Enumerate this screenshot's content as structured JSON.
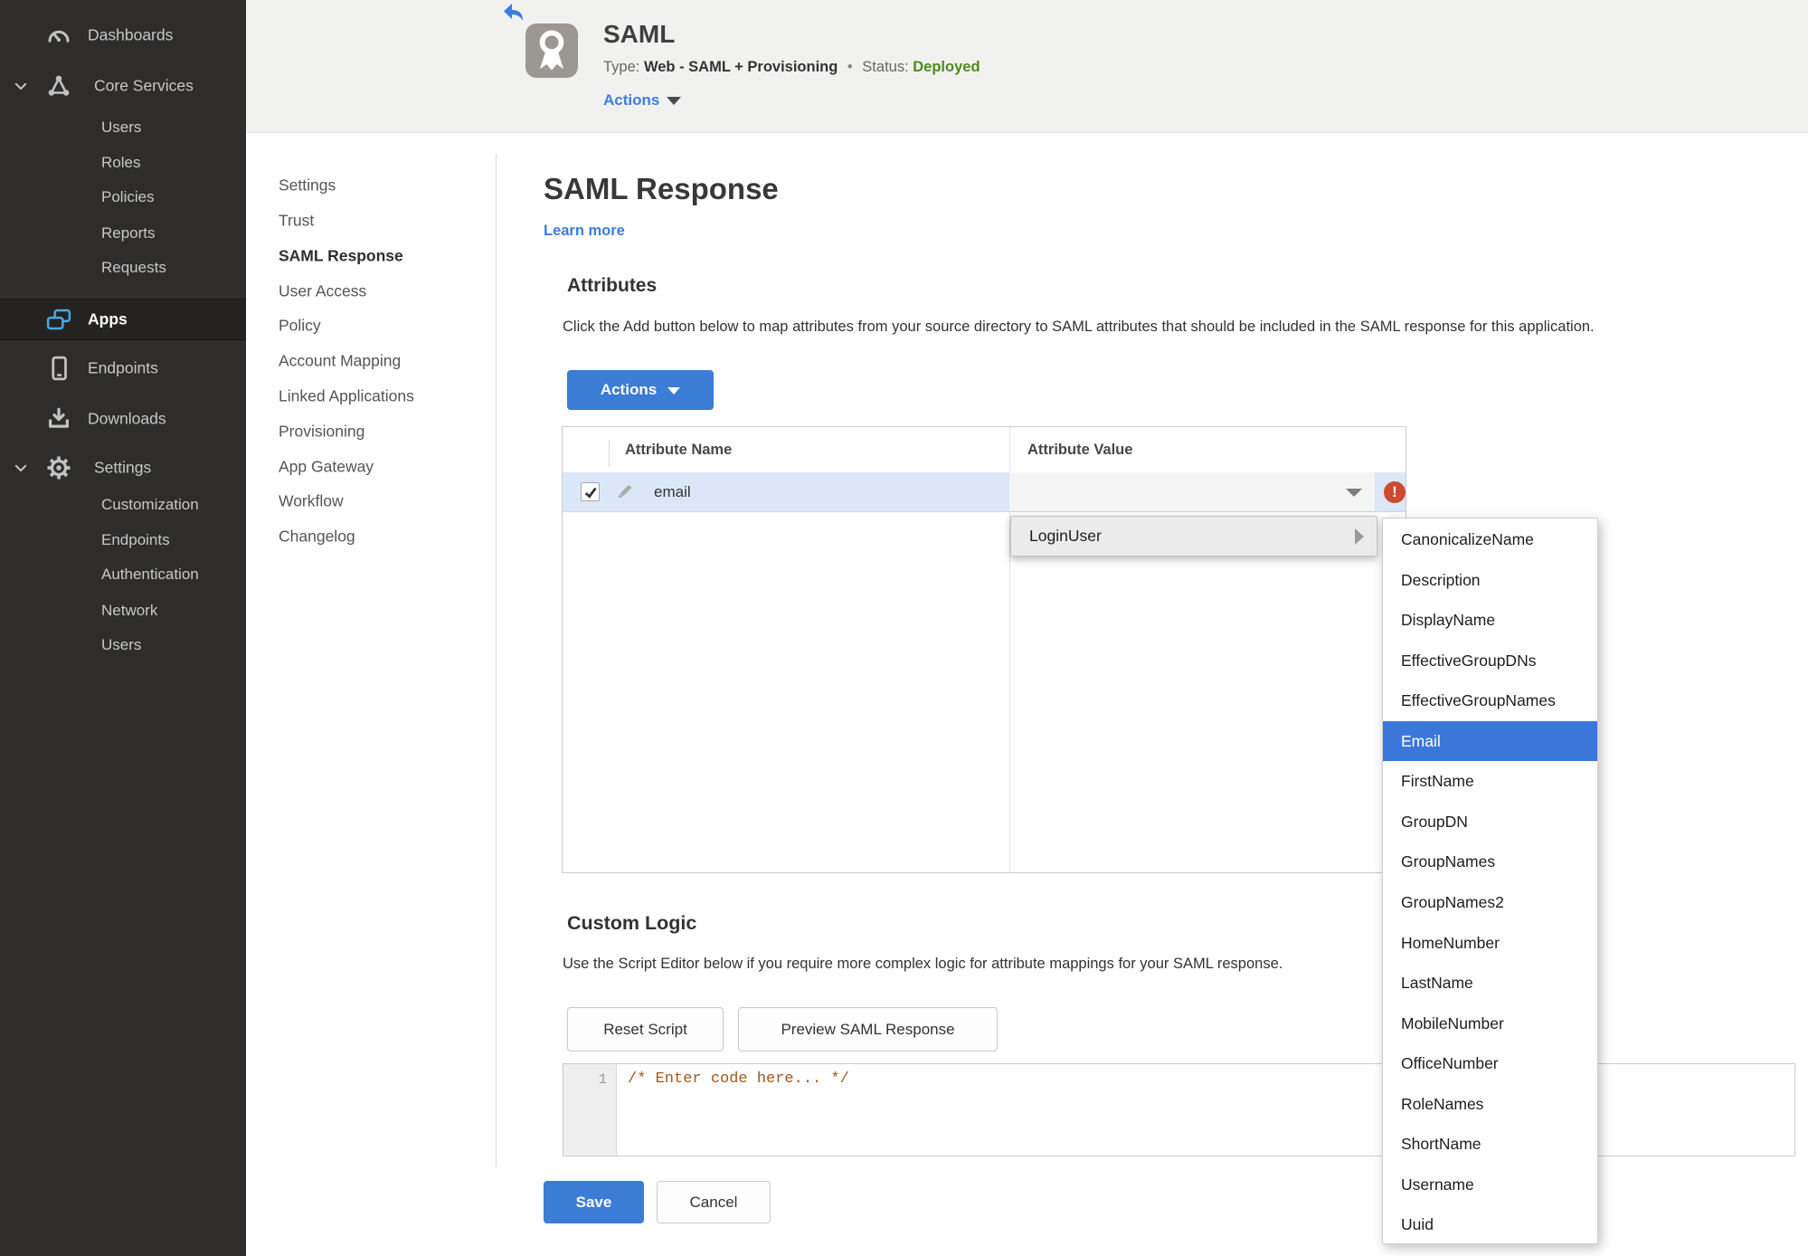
{
  "sidebar": {
    "items": [
      {
        "label": "Dashboards",
        "icon": "dashboard-icon"
      },
      {
        "label": "Core Services",
        "icon": "core-services-icon",
        "expanded": true,
        "children": [
          "Users",
          "Roles",
          "Policies",
          "Reports",
          "Requests"
        ]
      },
      {
        "label": "Apps",
        "icon": "apps-icon",
        "active": true
      },
      {
        "label": "Endpoints",
        "icon": "endpoints-icon"
      },
      {
        "label": "Downloads",
        "icon": "downloads-icon"
      },
      {
        "label": "Settings",
        "icon": "settings-icon",
        "expanded": true,
        "children": [
          "Customization",
          "Endpoints",
          "Authentication",
          "Network",
          "Users"
        ]
      }
    ]
  },
  "header": {
    "app_title": "SAML",
    "type_label": "Type:",
    "type_value": "Web - SAML + Provisioning",
    "separator": "•",
    "status_label": "Status:",
    "status_value": "Deployed",
    "actions_label": "Actions"
  },
  "subnav": {
    "active": "SAML Response",
    "items": [
      "Settings",
      "Trust",
      "SAML Response",
      "User Access",
      "Policy",
      "Account Mapping",
      "Linked Applications",
      "Provisioning",
      "App Gateway",
      "Workflow",
      "Changelog"
    ]
  },
  "main": {
    "title": "SAML Response",
    "learn_more": "Learn more",
    "attributes": {
      "heading": "Attributes",
      "description": "Click the Add button below to map attributes from your source directory to SAML attributes that should be included in the SAML response for this application.",
      "actions_button": "Actions",
      "table": {
        "columns": [
          "Attribute Name",
          "Attribute Value"
        ],
        "rows": [
          {
            "name": "email",
            "value": "",
            "checked": true,
            "error": true
          }
        ]
      }
    },
    "dropdown": {
      "root_item": "LoginUser",
      "selected": "Email",
      "submenu": [
        "CanonicalizeName",
        "Description",
        "DisplayName",
        "EffectiveGroupDNs",
        "EffectiveGroupNames",
        "Email",
        "FirstName",
        "GroupDN",
        "GroupNames",
        "GroupNames2",
        "HomeNumber",
        "LastName",
        "MobileNumber",
        "OfficeNumber",
        "RoleNames",
        "ShortName",
        "Username",
        "Uuid"
      ]
    },
    "custom_logic": {
      "heading": "Custom Logic",
      "description": "Use the Script Editor below if you require more complex logic for attribute mappings for your SAML response.",
      "reset_button": "Reset Script",
      "preview_button": "Preview SAML Response",
      "editor": {
        "line_number": "1",
        "code": "/* Enter code here... */"
      }
    },
    "footer": {
      "save": "Save",
      "cancel": "Cancel"
    }
  },
  "colors": {
    "accent_blue": "#3b7cd5",
    "link_blue": "#3b7ddd",
    "menu_selected_blue": "#3b77d9",
    "row_selected_blue": "#dbe7f7",
    "status_green": "#4e8b1d",
    "error_red": "#cd4a2e",
    "sidebar_bg": "#2e2d2c",
    "sidebar_active_bg": "#242322",
    "header_bg": "#f1f1f0",
    "code_text": "#a8551c"
  }
}
